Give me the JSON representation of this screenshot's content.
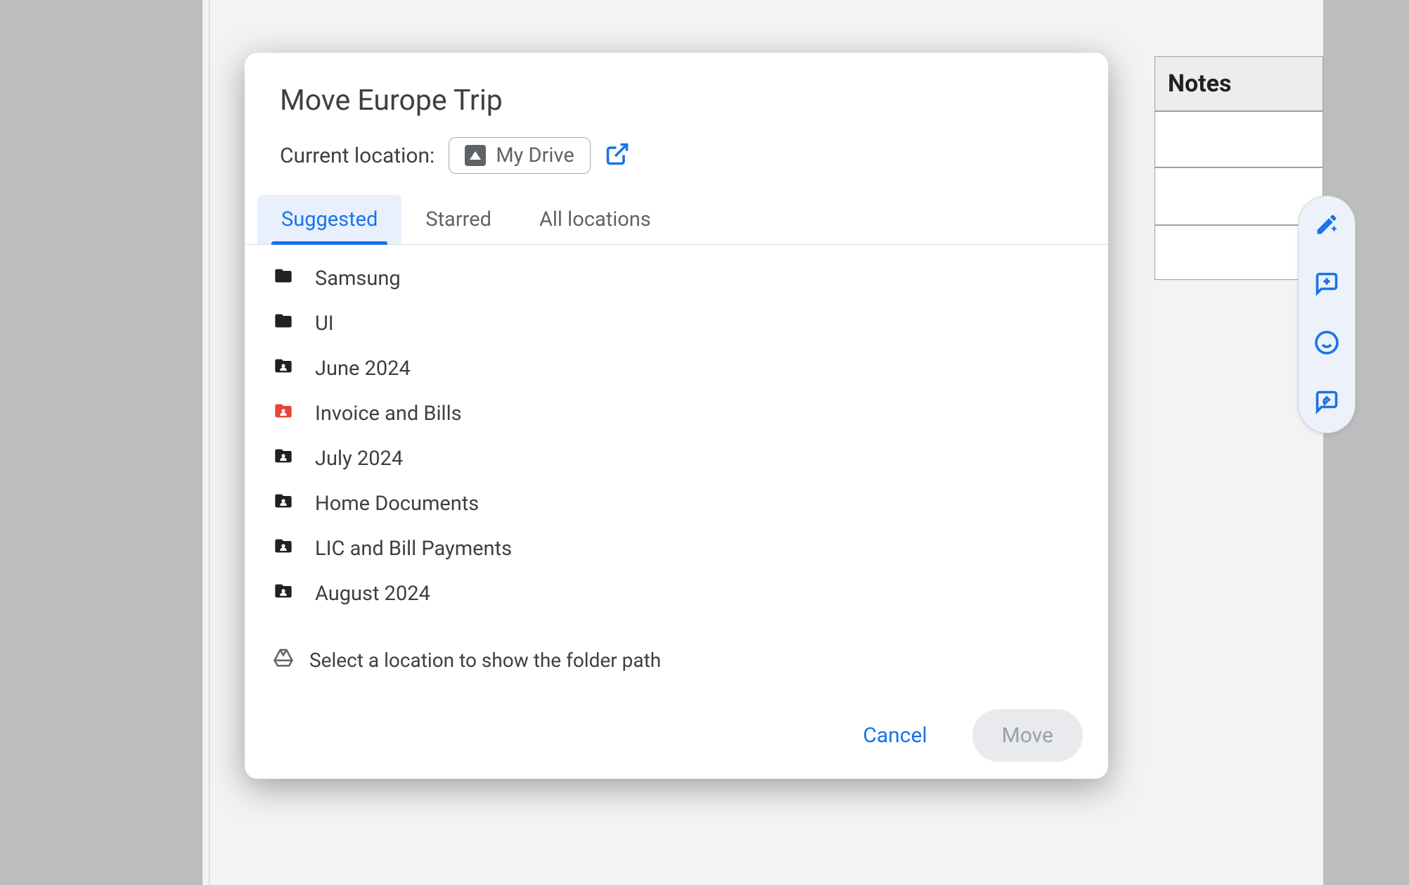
{
  "background": {
    "notes_header": "Notes"
  },
  "dialog": {
    "title": "Move Europe Trip",
    "location_label": "Current location:",
    "location_chip": "My Drive",
    "tabs": [
      {
        "label": "Suggested",
        "active": true
      },
      {
        "label": "Starred",
        "active": false
      },
      {
        "label": "All locations",
        "active": false
      }
    ],
    "folders": [
      {
        "name": "Samsung",
        "icon": "folder",
        "color": "#202124"
      },
      {
        "name": "UI",
        "icon": "folder",
        "color": "#202124"
      },
      {
        "name": "June 2024",
        "icon": "shared-folder",
        "color": "#202124"
      },
      {
        "name": "Invoice and Bills",
        "icon": "shared-folder",
        "color": "#ea4335"
      },
      {
        "name": "July 2024",
        "icon": "shared-folder",
        "color": "#202124"
      },
      {
        "name": "Home Documents",
        "icon": "shared-folder",
        "color": "#202124"
      },
      {
        "name": "LIC and Bill Payments",
        "icon": "shared-folder",
        "color": "#202124"
      },
      {
        "name": "August 2024",
        "icon": "shared-folder",
        "color": "#202124"
      }
    ],
    "hint": "Select a location to show the folder path",
    "cancel_label": "Cancel",
    "move_label": "Move"
  },
  "side_toolbar": {
    "icons": [
      "magic-pencil-icon",
      "add-comment-icon",
      "emoji-icon",
      "suggest-edit-icon"
    ]
  }
}
